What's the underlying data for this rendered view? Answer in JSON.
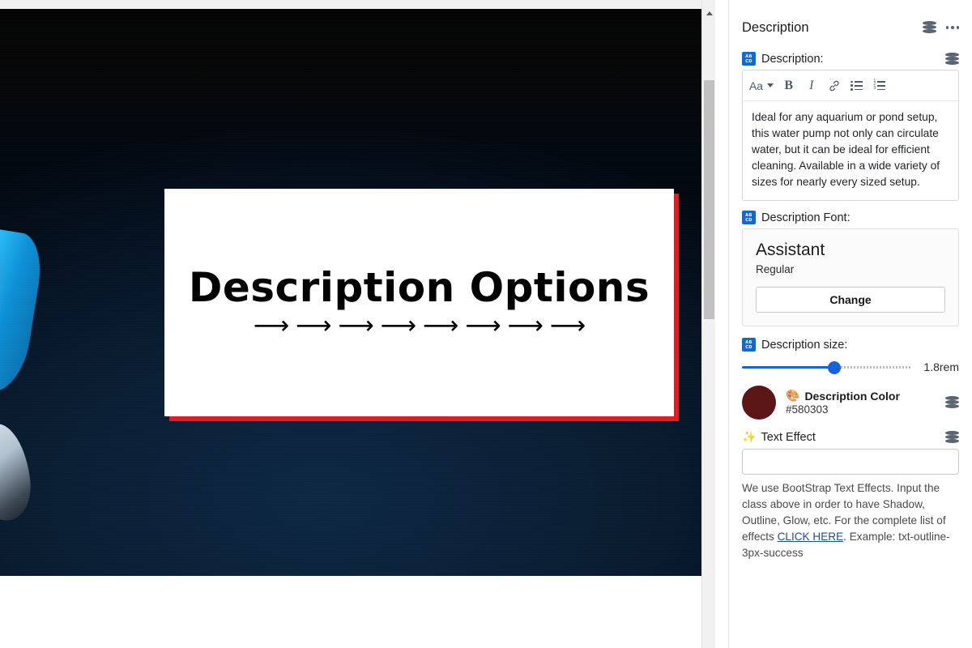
{
  "panel": {
    "title": "Description",
    "header_icons": [
      "database-stack-icon",
      "more-options-icon"
    ]
  },
  "description_field": {
    "label": "Description:",
    "icon": "abcd-text-field-icon",
    "toolbar": {
      "font_size_label": "Aa",
      "bold_label": "B",
      "italic_label": "I",
      "link_label": "ὑ7",
      "bullet_list_label": "",
      "numbered_list_label": ""
    },
    "value": "Ideal for any aquarium or pond setup, this water pump not only can circulate water, but it can be ideal for efficient cleaning. Available in a wide variety of sizes for nearly every sized setup."
  },
  "description_font": {
    "label": "Description Font:",
    "name": "Assistant",
    "style": "Regular",
    "change_button": "Change"
  },
  "description_size": {
    "label": "Description size:",
    "value": "1.8rem",
    "fill_percent": 55
  },
  "description_color": {
    "name": "Description Color",
    "hex": "#580303",
    "swatch_color": "#5d1616"
  },
  "text_effect": {
    "label": "Text Effect",
    "value": "",
    "help_before": "We use BootStrap Text Effects. Input the class above in order to have Shadow, Outline, Glow, etc. For the complete list of effects ",
    "help_link": "CLICK HERE",
    "help_after": ". Example: txt-outline-3px-success"
  },
  "canvas": {
    "card_title": "Description Options",
    "card_arrows": "⟶ ⟶ ⟶ ⟶ ⟶ ⟶ ⟶ ⟶",
    "card_shadow_color": "#e11b22",
    "background_color": "#061425"
  },
  "scrollbar": {
    "up_arrow": "scroll-up-arrow"
  }
}
